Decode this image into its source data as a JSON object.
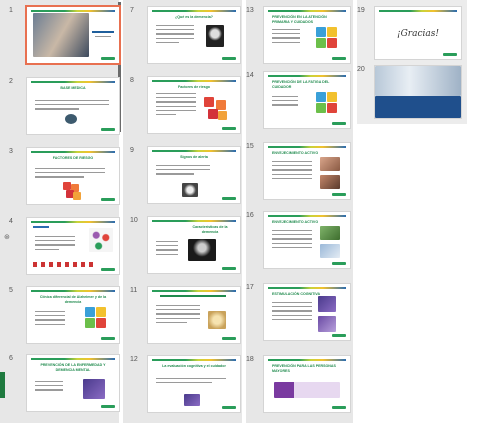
{
  "slides": [
    {
      "num": "1",
      "title": ""
    },
    {
      "num": "2",
      "title": "BASE MEDICA"
    },
    {
      "num": "3",
      "title": "FACTORES DE RIESGO"
    },
    {
      "num": "4",
      "title": ""
    },
    {
      "num": "5",
      "title": "Clínica diferencial de Alzheimer y de la demencia"
    },
    {
      "num": "6",
      "title": "PREVENCIÓN DE LA ENFERMEDAD Y DEMENCIA MENTAL"
    },
    {
      "num": "7",
      "title": "¿Qué es la demencia?"
    },
    {
      "num": "8",
      "title": "Factores de riesgo"
    },
    {
      "num": "9",
      "title": "Signos de alerta"
    },
    {
      "num": "10",
      "title": "Características de la demencia"
    },
    {
      "num": "11",
      "title": ""
    },
    {
      "num": "12",
      "title": "La evaluación cognitiva y el cuidador"
    },
    {
      "num": "13",
      "title": "PREVENCIÓN EN LA ATENCIÓN PRIMARIA Y CUIDADOS"
    },
    {
      "num": "14",
      "title": "PREVENCIÓN DE LA FATIGA DEL CUIDADOR"
    },
    {
      "num": "15",
      "title": "ENVEJECIMIENTO ACTIVO"
    },
    {
      "num": "16",
      "title": "ENVEJECIMIENTO ACTIVO"
    },
    {
      "num": "17",
      "title": "ESTIMULACIÓN COGNITIVA"
    },
    {
      "num": "18",
      "title": "PREVENCIÓN PARA LAS PERSONAS MAYORES"
    },
    {
      "num": "19",
      "title": "¡Gracias!"
    },
    {
      "num": "20",
      "title": ""
    }
  ],
  "colors": {
    "accent": "#1f8a4d",
    "selected": "#e87050"
  }
}
